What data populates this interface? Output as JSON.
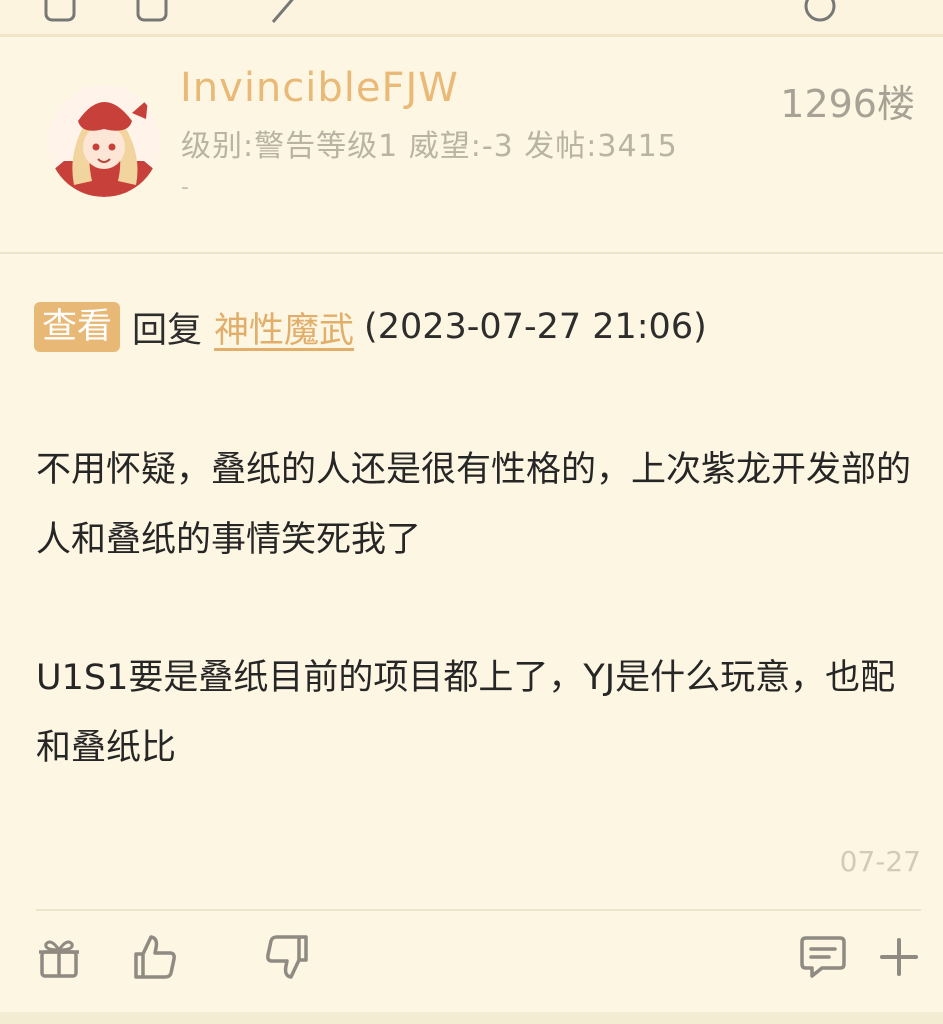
{
  "post": {
    "username": "InvincibleFJW",
    "user_meta": "级别:警告等级1 威望:-3 发帖:3415",
    "user_extra": "-",
    "floor": "1296楼",
    "reply": {
      "view_label": "查看",
      "reply_word": "回复",
      "reply_user": "神性魔武",
      "reply_time": "(2023-07-27 21:06)"
    },
    "content": {
      "p1": "不用怀疑，叠纸的人还是很有性格的，上次紫龙开发部的人和叠纸的事情笑死我了",
      "p2": "U1S1要是叠纸目前的项目都上了，YJ是什么玩意，也配和叠纸比"
    },
    "date": "07-27"
  },
  "actions": {
    "icons": [
      "gift-icon",
      "thumbs-up-icon",
      "thumbs-down-icon",
      "comment-icon",
      "plus-icon"
    ]
  },
  "colors": {
    "background": "#fdf6e2",
    "accent": "#e8b877",
    "text": "#262626",
    "muted": "#b9b3a3"
  }
}
